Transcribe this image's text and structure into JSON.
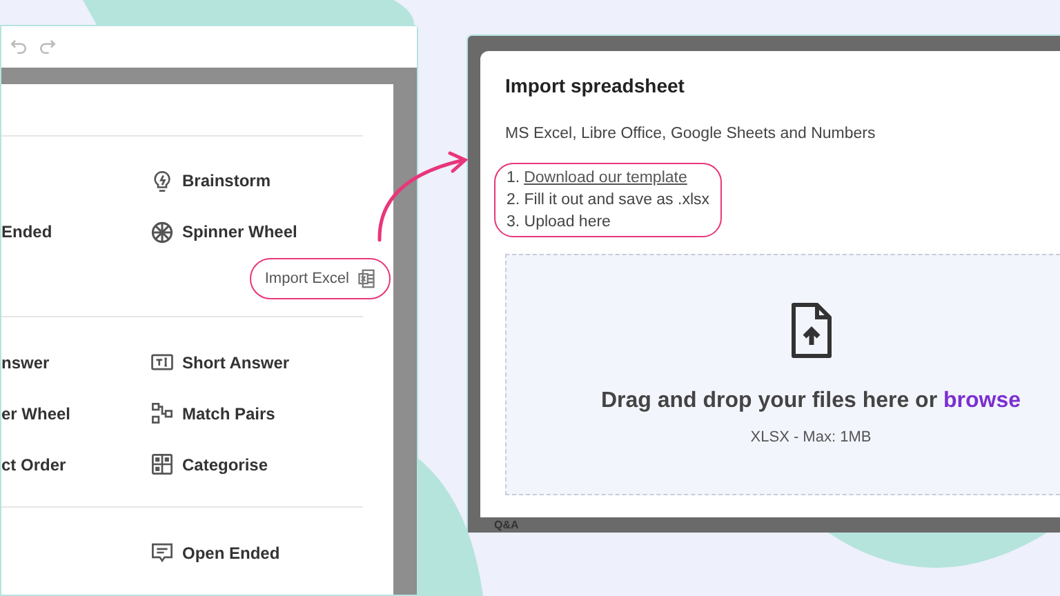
{
  "editor_window": {
    "sections": [
      {
        "rows": [
          {
            "right": "Brainstorm"
          },
          {
            "left": "Ended",
            "right": "Spinner Wheel"
          }
        ],
        "import_button": {
          "label": "Import Excel"
        }
      },
      {
        "rows": [
          {
            "left": "nswer",
            "right": "Short Answer"
          },
          {
            "left": "er Wheel",
            "right": "Match Pairs"
          },
          {
            "left": "ct Order",
            "right": "Categorise"
          }
        ]
      },
      {
        "rows": [
          {
            "right": "Open Ended"
          }
        ]
      }
    ]
  },
  "import_dialog": {
    "title": "Import spreadsheet",
    "subtitle": "MS Excel, Libre Office, Google Sheets and Numbers",
    "steps": [
      {
        "kind": "link",
        "number": "1.",
        "text": "Download our template"
      },
      {
        "kind": "text",
        "text": "2. Fill it out and save as .xlsx"
      },
      {
        "kind": "text",
        "text": "3. Upload here"
      }
    ],
    "dropzone": {
      "prompt": "Drag and drop your files here or",
      "browse": "browse",
      "hint": "XLSX - Max: 1MB"
    },
    "background_item": "Q&A"
  }
}
